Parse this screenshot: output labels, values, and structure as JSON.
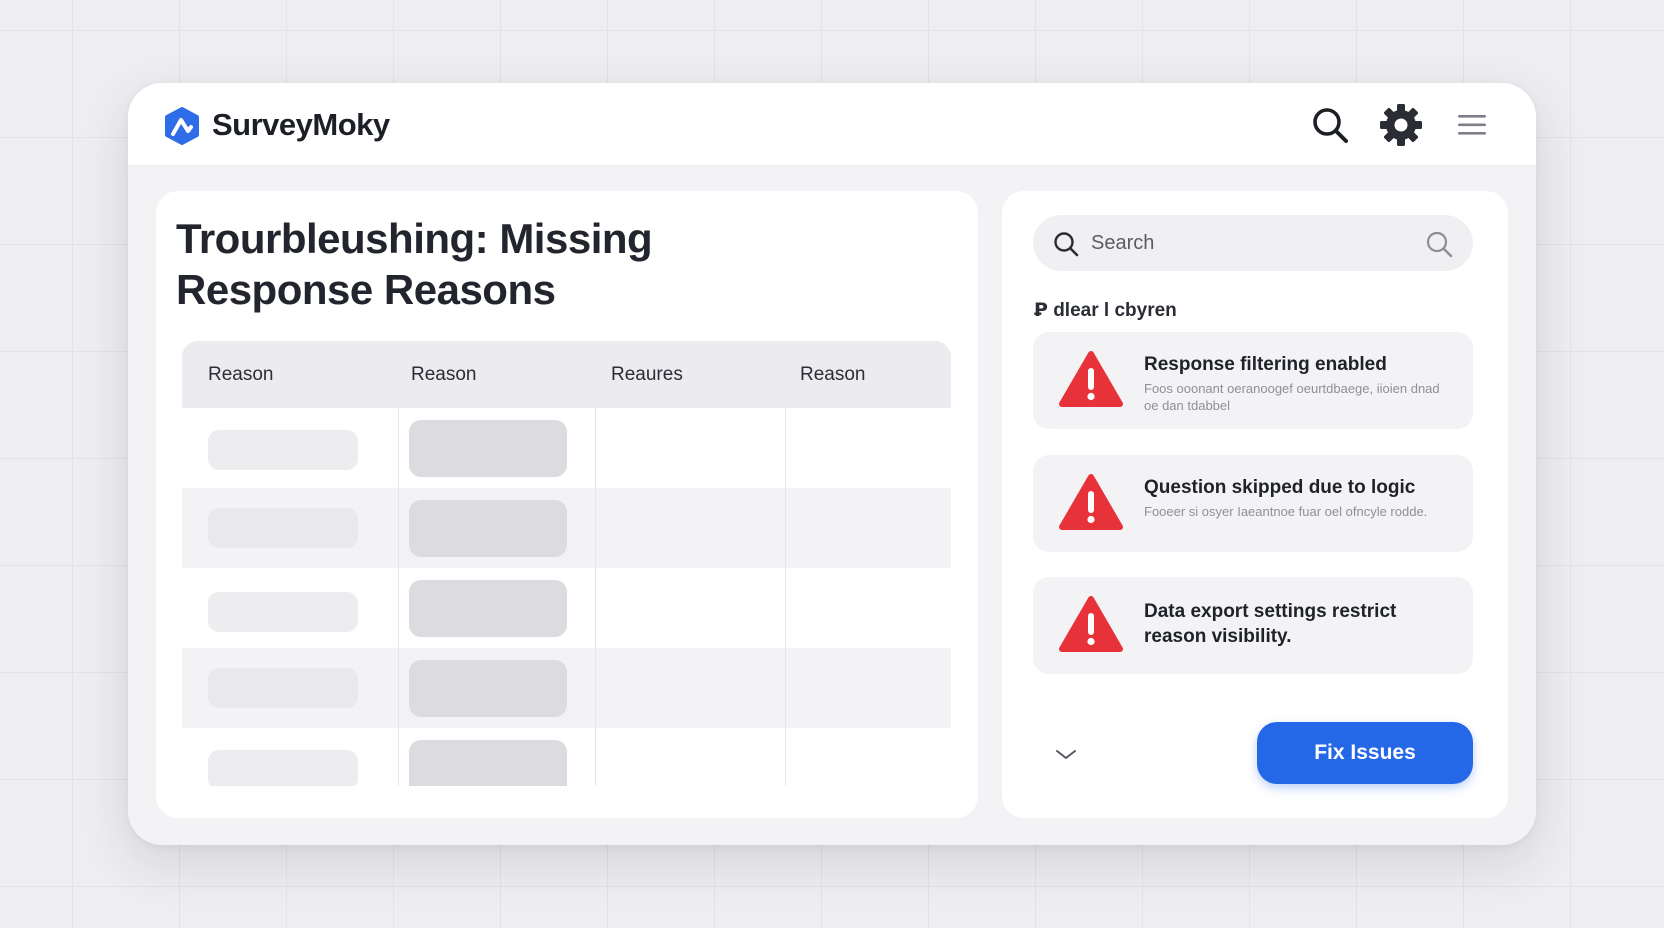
{
  "app": {
    "name": "SurveyMoky"
  },
  "page": {
    "title": "Trourbleushing: Missing Response Reasons"
  },
  "table": {
    "headers": [
      "Reason",
      "Reason",
      "Reaures",
      "Reason"
    ]
  },
  "search": {
    "placeholder": "Search"
  },
  "issues_section": {
    "label": "Ꝑ dlear l cbyren",
    "items": [
      {
        "title": "Response filtering enabled",
        "description": "Foos ooonant oeranoogef oeurtdbaege, iioien dnad oe dan tdabbel"
      },
      {
        "title": "Question skipped due to logic",
        "description": "Fooeer si osyer Iaeantnoe fuar oel ofncyle rodde."
      },
      {
        "title": "Data export settings restrict reason visibility.",
        "description": ""
      }
    ]
  },
  "actions": {
    "fix_label": "Fix Issues"
  },
  "colors": {
    "accent": "#2468e8",
    "warning": "#e8323a",
    "brand": "#2f6de8"
  },
  "icons": [
    "logo-icon",
    "search-icon",
    "gear-icon",
    "menu-icon",
    "warning-icon",
    "chevron-down-icon"
  ]
}
